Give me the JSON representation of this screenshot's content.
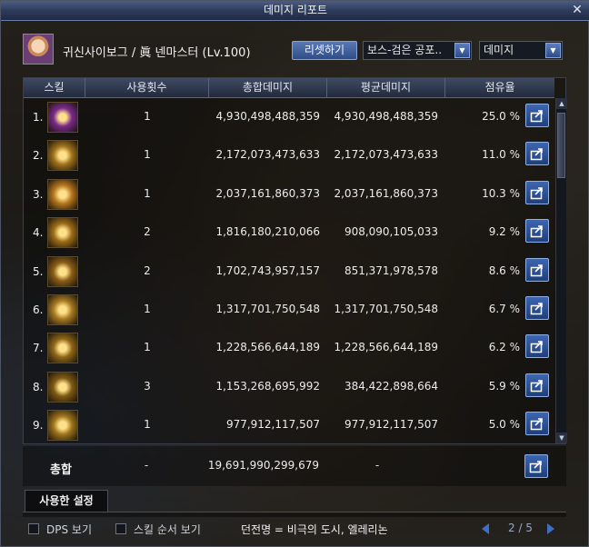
{
  "window": {
    "title": "데미지 리포트"
  },
  "header": {
    "character": "귀신사이보그 / 眞 넨마스터 (Lv.100)",
    "reset_label": "리셋하기",
    "boss_select": "보스-검은 공포..",
    "mode_select": "데미지"
  },
  "table": {
    "columns": [
      "스킬",
      "사용횟수",
      "총합데미지",
      "평균데미지",
      "점유율"
    ],
    "rows": [
      {
        "rank": "1.",
        "uses": "1",
        "total": "4,930,498,488,359",
        "average": "4,930,498,488,359",
        "share": "25.0 %",
        "icon": "purple-crown-skill-icon",
        "color": "#7a2a8a"
      },
      {
        "rank": "2.",
        "uses": "1",
        "total": "2,172,073,473,633",
        "average": "2,172,073,473,633",
        "share": "11.0 %",
        "icon": "golden-burst-skill-icon",
        "color": "#a0721c"
      },
      {
        "rank": "3.",
        "uses": "1",
        "total": "2,037,161,860,373",
        "average": "2,037,161,860,373",
        "share": "10.3 %",
        "icon": "golden-aura-skill-icon",
        "color": "#b5761e"
      },
      {
        "rank": "4.",
        "uses": "2",
        "total": "1,816,180,210,066",
        "average": "908,090,105,033",
        "share": "9.2 %",
        "icon": "golden-beast-skill-icon",
        "color": "#9c6c18"
      },
      {
        "rank": "5.",
        "uses": "2",
        "total": "1,702,743,957,157",
        "average": "851,371,978,578",
        "share": "8.6 %",
        "icon": "golden-vortex-skill-icon",
        "color": "#8a5e16"
      },
      {
        "rank": "6.",
        "uses": "1",
        "total": "1,317,701,750,548",
        "average": "1,317,701,750,548",
        "share": "6.7 %",
        "icon": "golden-lion-skill-icon",
        "color": "#a87a22"
      },
      {
        "rank": "7.",
        "uses": "1",
        "total": "1,228,566,644,189",
        "average": "1,228,566,644,189",
        "share": "6.2 %",
        "icon": "golden-strike-skill-icon",
        "color": "#8f6618"
      },
      {
        "rank": "8.",
        "uses": "3",
        "total": "1,153,268,695,992",
        "average": "384,422,898,664",
        "share": "5.9 %",
        "icon": "golden-ring-skill-icon",
        "color": "#7f5a14"
      },
      {
        "rank": "9.",
        "uses": "1",
        "total": "977,912,117,507",
        "average": "977,912,117,507",
        "share": "5.0 %",
        "icon": "golden-orb-skill-icon",
        "color": "#9e741c"
      }
    ]
  },
  "totals": {
    "label": "총합",
    "uses": "-",
    "total": "19,691,990,299,679",
    "average": "-"
  },
  "tabs": {
    "used_settings": "사용한 설정"
  },
  "footer": {
    "dps_label": "DPS 보기",
    "order_label": "스킬 순서 보기",
    "dungeon": "던전명 = 비극의 도시, 엘레리논",
    "page": "2 / 5"
  },
  "colors": {
    "accent": "#3d66b0",
    "title_bar": "#2e3c5c"
  }
}
